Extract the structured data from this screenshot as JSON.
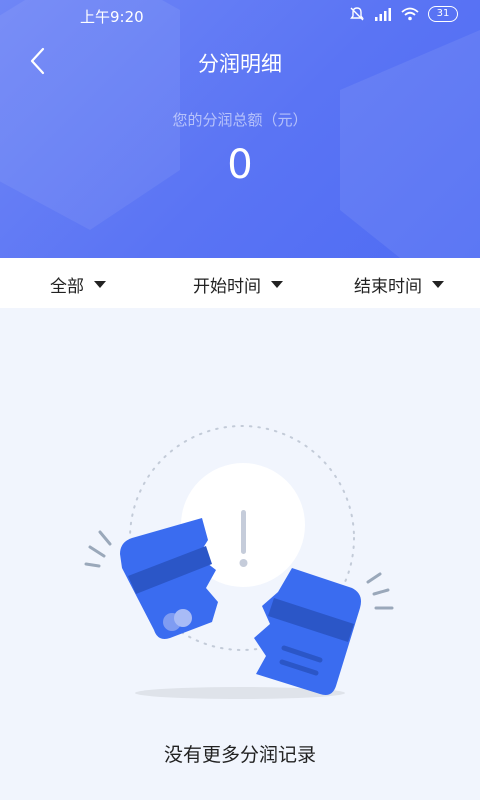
{
  "status_bar": {
    "time": "上午9:20",
    "battery": "31",
    "icons": [
      "mute-icon",
      "signal-icon",
      "wifi-icon",
      "battery-icon"
    ]
  },
  "header": {
    "title": "分润明细",
    "total_label": "您的分润总额（元）",
    "total_amount": "0",
    "back_icon": "chevron-left-icon"
  },
  "filters": {
    "all": "全部",
    "start_time": "开始时间",
    "end_time": "结束时间"
  },
  "empty_state": {
    "message": "没有更多分润记录",
    "illustration": "broken-card-icon"
  },
  "colors": {
    "header_gradient_start": "#6f86f6",
    "header_gradient_end": "#4f6cf3",
    "card_blue": "#3a6cf0",
    "background": "#f1f5fd"
  }
}
